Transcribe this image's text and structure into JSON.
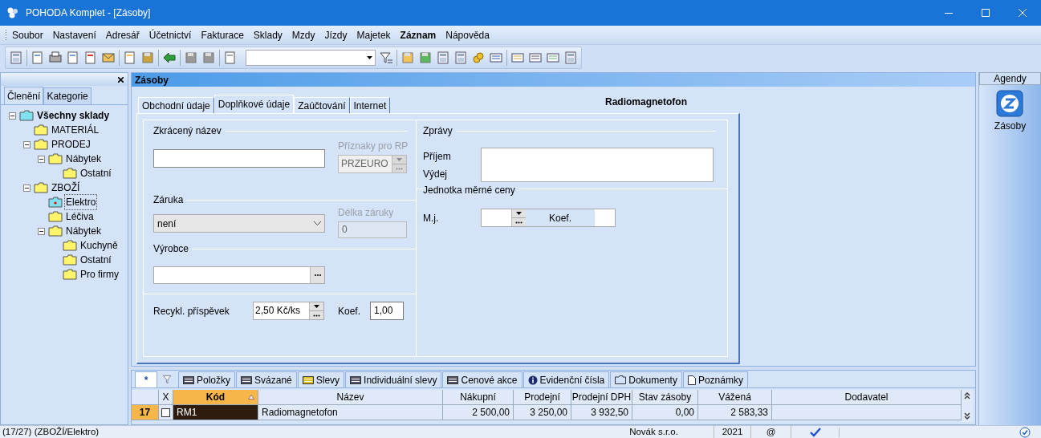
{
  "window": {
    "title": "POHODA Komplet - [Zásoby]"
  },
  "menu": [
    {
      "label": "Soubor",
      "emphasized": false
    },
    {
      "label": "Nastavení",
      "emphasized": false
    },
    {
      "label": "Adresář",
      "emphasized": false
    },
    {
      "label": "Účetnictví",
      "emphasized": false
    },
    {
      "label": "Fakturace",
      "emphasized": false
    },
    {
      "label": "Sklady",
      "emphasized": false
    },
    {
      "label": "Mzdy",
      "emphasized": false
    },
    {
      "label": "Jízdy",
      "emphasized": false
    },
    {
      "label": "Majetek",
      "emphasized": false
    },
    {
      "label": "Záznam",
      "emphasized": true
    },
    {
      "label": "Nápověda",
      "emphasized": false
    }
  ],
  "sidebar": {
    "tabs": [
      {
        "label": "Členění",
        "selected": true
      },
      {
        "label": "Kategorie",
        "selected": false
      }
    ],
    "tree": [
      {
        "label": "Všechny sklady",
        "selected": false,
        "expanded": true,
        "children": [
          {
            "label": "MATERIÁL",
            "selected": false
          },
          {
            "label": "PRODEJ",
            "selected": false,
            "expanded": true,
            "children": [
              {
                "label": "Nábytek",
                "selected": false,
                "expanded": true,
                "children": [
                  {
                    "label": "Ostatní",
                    "selected": false
                  }
                ]
              }
            ]
          },
          {
            "label": "ZBOŽÍ",
            "selected": false,
            "expanded": true,
            "children": [
              {
                "label": "Elektro",
                "selected": true
              },
              {
                "label": "Léčiva",
                "selected": false
              },
              {
                "label": "Nábytek",
                "selected": false,
                "expanded": true,
                "children": [
                  {
                    "label": "Kuchyně",
                    "selected": false
                  },
                  {
                    "label": "Ostatní",
                    "selected": false
                  },
                  {
                    "label": "Pro firmy",
                    "selected": false
                  }
                ]
              }
            ]
          }
        ]
      }
    ]
  },
  "panel": {
    "title": "Zásoby",
    "record_title": "Radiomagnetofon",
    "tabs": [
      {
        "label": "Obchodní údaje",
        "selected": false
      },
      {
        "label": "Doplňkové údaje",
        "selected": true
      },
      {
        "label": "Zaúčtování",
        "selected": false
      },
      {
        "label": "Internet",
        "selected": false
      }
    ],
    "form": {
      "short_name": {
        "label": "Zkrácený název"
      },
      "rp_flags": {
        "label": "Příznaky pro RP",
        "value": "PRZEURO",
        "disabled": true
      },
      "warranty": {
        "label": "Záruka",
        "value": "není"
      },
      "warranty_length": {
        "label": "Délka záruky",
        "value": "0",
        "disabled": true
      },
      "manufacturer": {
        "label": "Výrobce"
      },
      "recycling": {
        "label": "Recykl. příspěvek",
        "value": "2,50 Kč/ks",
        "coef_label": "Koef.",
        "coef_value": "1,00"
      },
      "messages": {
        "label": "Zprávy",
        "receipt": "Příjem",
        "issue": "Výdej"
      },
      "unit_price": {
        "label": "Jednotka měrné ceny",
        "unit_label": "M.j.",
        "coef_label": "Koef."
      }
    }
  },
  "bottom": {
    "tabs": [
      {
        "label": "*",
        "selected": true
      },
      {
        "label": "Položky",
        "selected": false
      },
      {
        "label": "Svázané",
        "selected": false
      },
      {
        "label": "Slevy",
        "selected": false
      },
      {
        "label": "Individuální slevy",
        "selected": false
      },
      {
        "label": "Cenové akce",
        "selected": false
      },
      {
        "label": "Evidenční čísla",
        "selected": false
      },
      {
        "label": "Dokumenty",
        "selected": false
      },
      {
        "label": "Poznámky",
        "selected": false
      }
    ],
    "table": {
      "check_column": "X",
      "columns": [
        {
          "label": "Kód",
          "sorted": true
        },
        {
          "label": "Název",
          "sorted": false
        },
        {
          "label": "Nákupní",
          "sorted": false
        },
        {
          "label": "Prodejní",
          "sorted": false
        },
        {
          "label": "Prodejní DPH",
          "sorted": false
        },
        {
          "label": "Stav zásoby",
          "sorted": false
        },
        {
          "label": "Vážená",
          "sorted": false
        },
        {
          "label": "Dodavatel",
          "sorted": false
        }
      ],
      "rows": [
        {
          "number": "17",
          "checked": false,
          "selected": true,
          "cells": [
            "RM1",
            "Radiomagnetofon",
            "2 500,00",
            "3 250,00",
            "3 932,50",
            "0,00",
            "2 583,33"
          ]
        }
      ]
    }
  },
  "agendas": {
    "title": "Agendy",
    "items": [
      {
        "label": "Zásoby"
      }
    ]
  },
  "status_bar": {
    "position": "(17/27) (ZBOŽÍ/Elektro)",
    "company": "Novák s.r.o.",
    "year": "2021",
    "email": "@"
  }
}
